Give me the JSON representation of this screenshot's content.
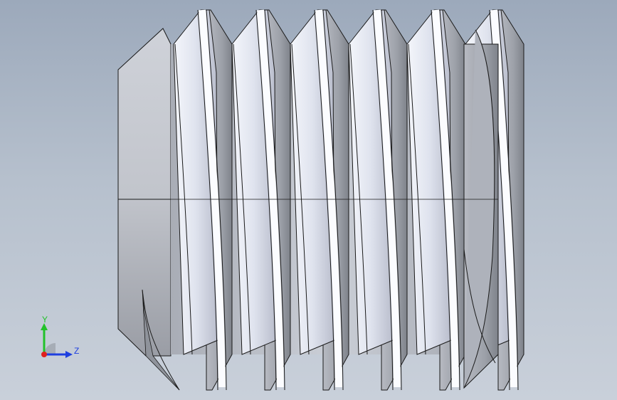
{
  "viewport": {
    "background_top": "#9ca9bb",
    "background_bottom": "#c9d0da"
  },
  "model": {
    "part_type": "threaded set screw (cup point, slotted)",
    "face_color_light": "#e8ebf2",
    "face_color_mid": "#c7cbd4",
    "face_color_dark": "#8e929b",
    "edge_color": "#1a1a1a",
    "thread_count_visible": 6
  },
  "triad": {
    "y_label": "Y",
    "z_label": "Z",
    "y_color": "#22c22a",
    "z_color": "#1e3fe0",
    "x_color": "#e0201e"
  }
}
